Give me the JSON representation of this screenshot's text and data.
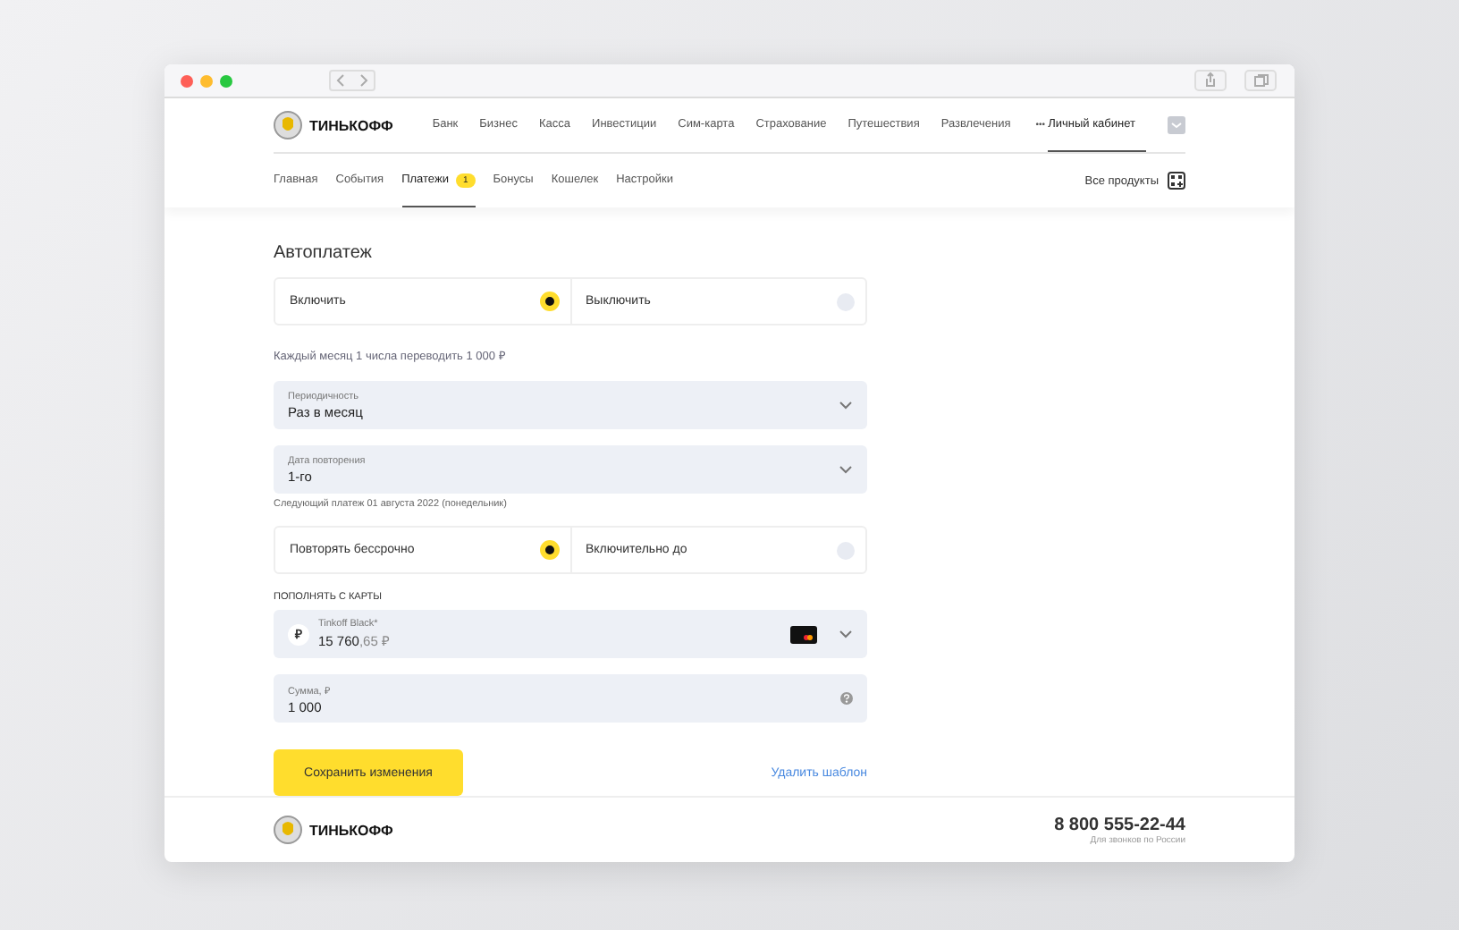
{
  "brand": "ТИНЬКОФФ",
  "top_nav": [
    {
      "label": "Банк",
      "selected": false
    },
    {
      "label": "Бизнес",
      "selected": false
    },
    {
      "label": "Касса",
      "selected": false
    },
    {
      "label": "Инвестиции",
      "selected": false
    },
    {
      "label": "Сим-карта",
      "selected": false
    },
    {
      "label": "Страхование",
      "selected": false
    },
    {
      "label": "Путешествия",
      "selected": false
    },
    {
      "label": "Развлечения",
      "selected": false
    }
  ],
  "more": "•••",
  "account": {
    "label": "Личный кабинет",
    "selected": true
  },
  "sub_nav": [
    {
      "label": "Главная",
      "selected": false
    },
    {
      "label": "События",
      "selected": false
    },
    {
      "label": "Платежи",
      "selected": true,
      "badge": "1"
    },
    {
      "label": "Бонусы",
      "selected": false
    },
    {
      "label": "Кошелек",
      "selected": false
    },
    {
      "label": "Настройки",
      "selected": false
    }
  ],
  "all_products": "Все продукты",
  "title": "Автоплатеж",
  "toggle": [
    {
      "label": "Включить",
      "selected": true
    },
    {
      "label": "Выключить",
      "selected": false
    }
  ],
  "summary": "Каждый месяц 1 числа переводить 1 000 ₽",
  "periodicity": {
    "label": "Периодичность",
    "value": "Раз в месяц"
  },
  "repeat_date": {
    "label": "Дата повторения",
    "value": "1-го"
  },
  "next_payment": "Следующий платеж 01 августа 2022 (понедельник)",
  "duration": [
    {
      "label": "Повторять бессрочно",
      "selected": true
    },
    {
      "label": "Включительно до",
      "selected": false
    }
  ],
  "card_section": "ПОПОЛНЯТЬ С КАРТЫ",
  "card": {
    "icon": "₽",
    "name": "Tinkoff Black*",
    "balance_main": "15 760",
    "balance_fraction": ",65 ₽"
  },
  "amount": {
    "label": "Сумма, ₽",
    "value": "1 000"
  },
  "save_button": "Сохранить изменения",
  "delete_link": "Удалить шаблон",
  "footer": {
    "brand": "ТИНЬКОФФ",
    "phone": "8 800 555-22-44",
    "phone_note": "Для звонков по России"
  }
}
